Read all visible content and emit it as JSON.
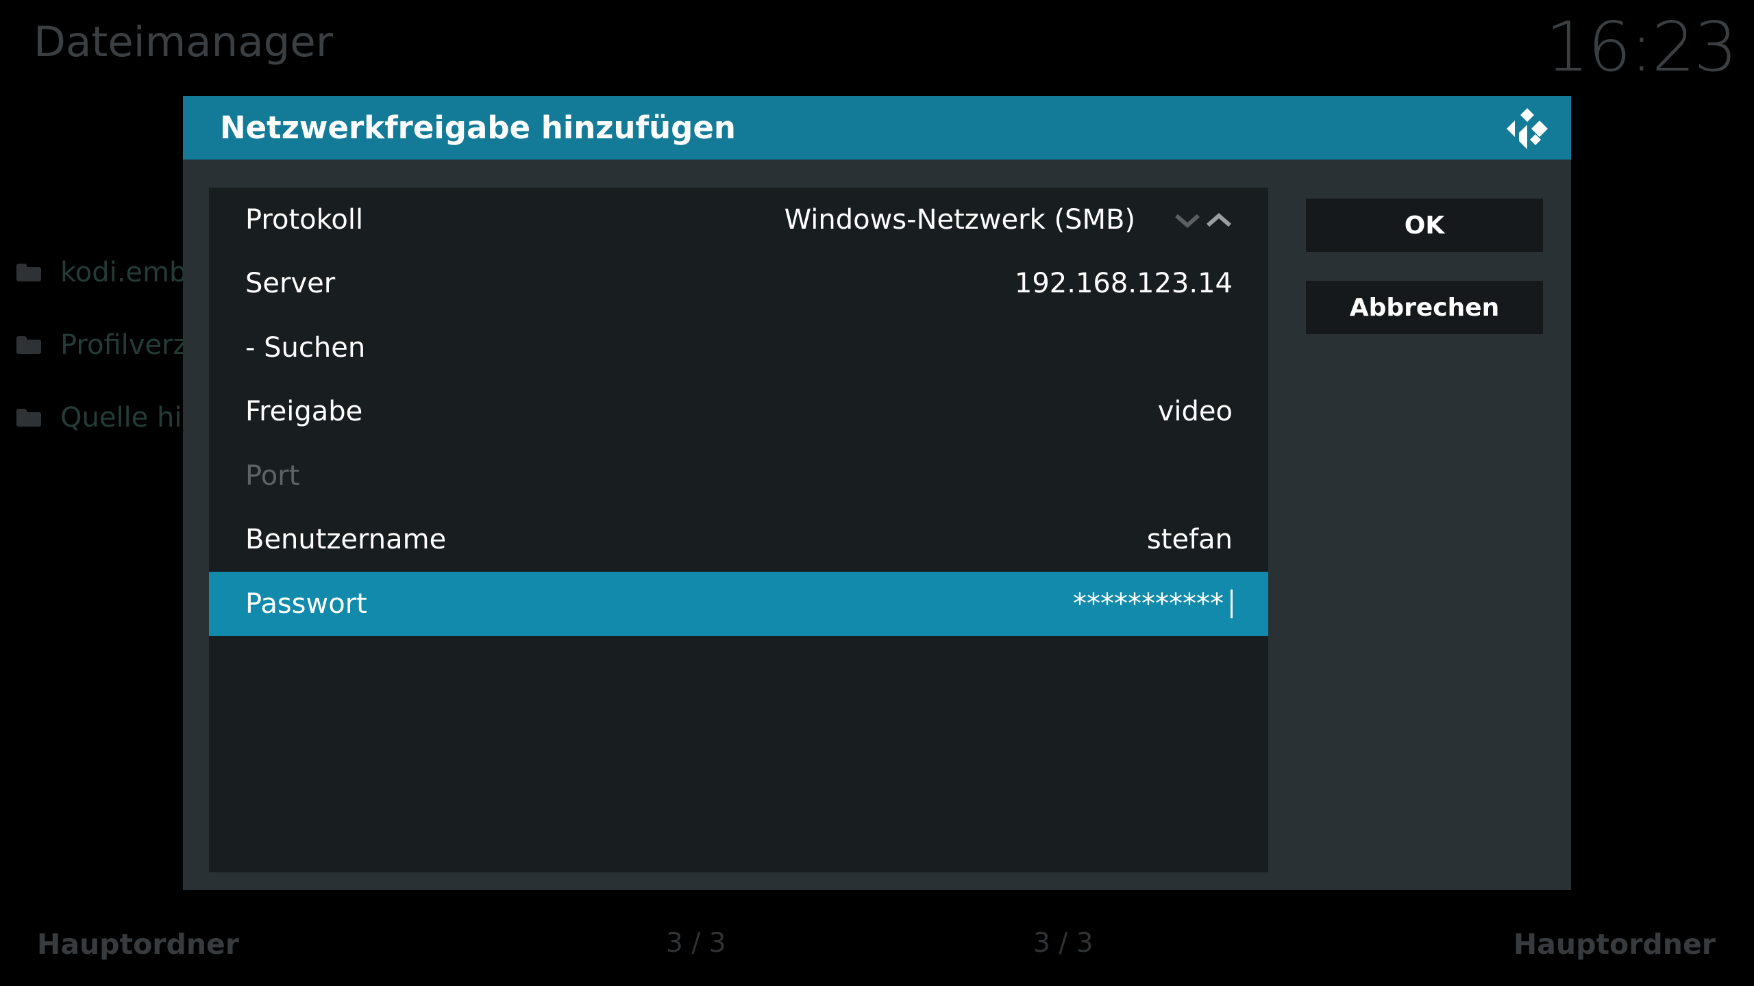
{
  "background": {
    "title": "Dateimanager",
    "clock": "16:23",
    "list_items": [
      "kodi.emby",
      "Profilverze",
      "Quelle hin"
    ],
    "footer_left": "Hauptordner",
    "footer_center_left": "3 / 3",
    "footer_center_right": "3 / 3",
    "footer_right": "Hauptordner"
  },
  "dialog": {
    "title": "Netzwerkfreigabe hinzufügen",
    "accent_color": "#137b97",
    "rows": [
      {
        "label": "Protokoll",
        "value": "Windows-Netzwerk (SMB)",
        "spinner": true
      },
      {
        "label": "Server",
        "value": "192.168.123.14"
      },
      {
        "label": "- Suchen",
        "value": ""
      },
      {
        "label": "Freigabe",
        "value": "video"
      },
      {
        "label": "Port",
        "value": "",
        "disabled": true
      },
      {
        "label": "Benutzername",
        "value": "stefan"
      },
      {
        "label": "Passwort",
        "value": "***********",
        "selected": true
      }
    ],
    "buttons": {
      "ok": "OK",
      "cancel": "Abbrechen"
    }
  }
}
